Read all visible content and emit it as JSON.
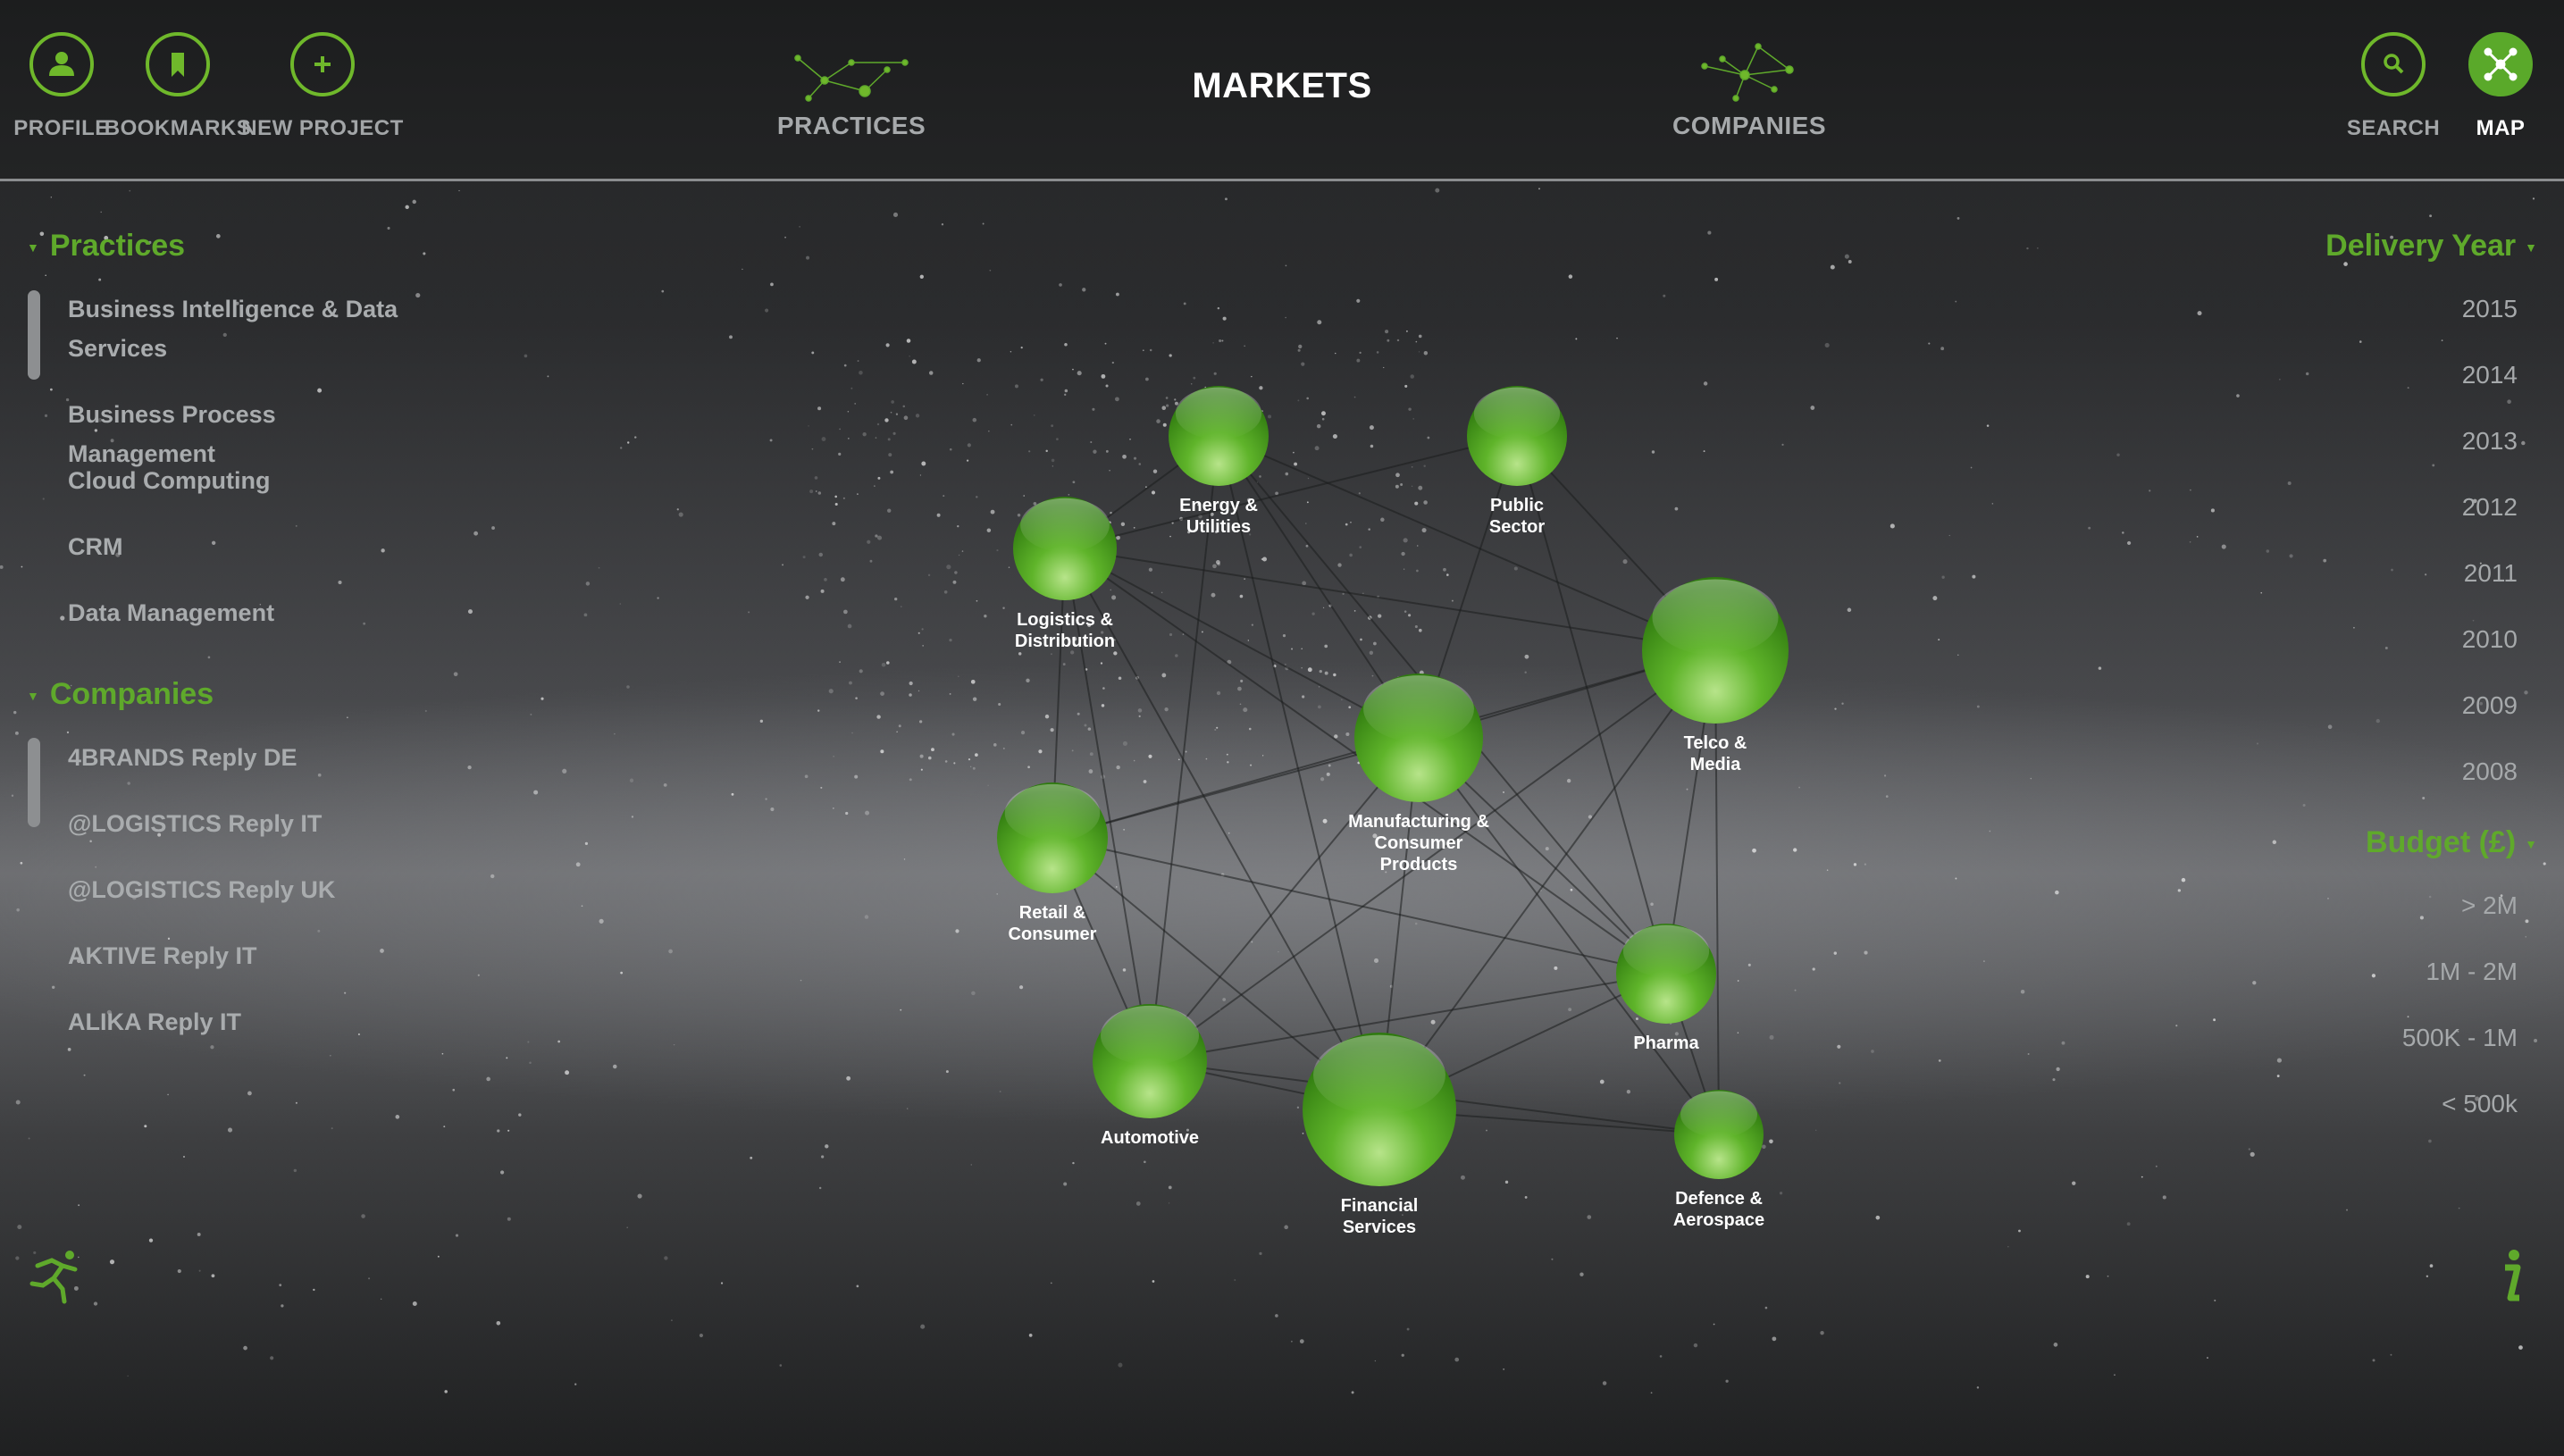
{
  "header": {
    "title": "MARKETS",
    "profile": "PROFILE",
    "bookmarks": "BOOKMARKS",
    "new_project": "NEW PROJECT",
    "practices": "PRACTICES",
    "companies": "COMPANIES",
    "search": "SEARCH",
    "map": "MAP"
  },
  "left": {
    "practices_title": "Practices",
    "practices": [
      "Business Intelligence & Data Services",
      "Business Process Management",
      "Cloud Computing",
      "CRM",
      "Data Management"
    ],
    "companies_title": "Companies",
    "companies": [
      "4BRANDS Reply DE",
      "@LOGISTICS Reply IT",
      "@LOGISTICS Reply UK",
      "AKTIVE Reply IT",
      "ALIKA Reply IT"
    ]
  },
  "right": {
    "delivery_title": "Delivery Year",
    "years": [
      "2015",
      "2014",
      "2013",
      "2012",
      "2011",
      "2010",
      "2009",
      "2008"
    ],
    "budget_title": "Budget (£)",
    "budgets": [
      "> 2M",
      "1M - 2M",
      "500K - 1M",
      "< 500k"
    ]
  },
  "network": {
    "nodes": [
      {
        "id": "energy",
        "lines": [
          "Energy &",
          "Utilities"
        ]
      },
      {
        "id": "public",
        "lines": [
          "Public",
          "Sector"
        ]
      },
      {
        "id": "logistics",
        "lines": [
          "Logistics &",
          "Distribution"
        ]
      },
      {
        "id": "telco",
        "lines": [
          "Telco &",
          "Media"
        ]
      },
      {
        "id": "manufacturing",
        "lines": [
          "Manufacturing &",
          "Consumer",
          "Products"
        ]
      },
      {
        "id": "retail",
        "lines": [
          "Retail &",
          "Consumer"
        ]
      },
      {
        "id": "pharma",
        "lines": [
          "Pharma"
        ]
      },
      {
        "id": "automotive",
        "lines": [
          "Automotive"
        ]
      },
      {
        "id": "financial",
        "lines": [
          "Financial",
          "Services"
        ]
      },
      {
        "id": "defence",
        "lines": [
          "Defence &",
          "Aerospace"
        ]
      }
    ]
  },
  "colors": {
    "accent": "#5fa92b",
    "node": "#4fa11e"
  },
  "icons": {
    "profile": "person-icon",
    "bookmarks": "bookmark-icon",
    "new_project": "plus-icon",
    "search": "search-icon",
    "map": "network-icon",
    "runner": "runner-icon",
    "info": "info-icon"
  }
}
